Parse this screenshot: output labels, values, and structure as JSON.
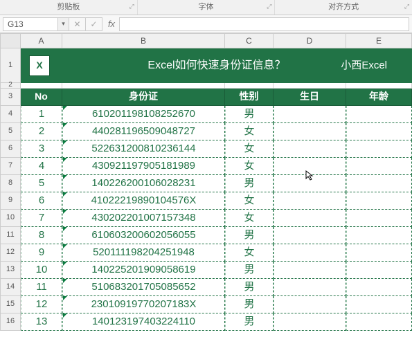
{
  "ribbon": {
    "sections": [
      "剪贴板",
      "字体",
      "对齐方式"
    ]
  },
  "namebox": "G13",
  "colHeaders": [
    "A",
    "B",
    "C",
    "D",
    "E"
  ],
  "title": {
    "icon": "X",
    "text": "Excel如何快速身份证信息？",
    "author": "小西Excel"
  },
  "headers": {
    "no": "No",
    "id": "身份证",
    "gender": "性别",
    "birth": "生日",
    "age": "年龄"
  },
  "rows": [
    {
      "n": "1",
      "id": "610201198108252670",
      "g": "男"
    },
    {
      "n": "2",
      "id": "440281196509048727",
      "g": "女"
    },
    {
      "n": "3",
      "id": "522631200810236144",
      "g": "女"
    },
    {
      "n": "4",
      "id": "430921197905181989",
      "g": "女"
    },
    {
      "n": "5",
      "id": "140226200106028231",
      "g": "男"
    },
    {
      "n": "6",
      "id": "41022219890104576X",
      "g": "女"
    },
    {
      "n": "7",
      "id": "430202201007157348",
      "g": "女"
    },
    {
      "n": "8",
      "id": "610603200602056055",
      "g": "男"
    },
    {
      "n": "9",
      "id": "520111198204251948",
      "g": "女"
    },
    {
      "n": "10",
      "id": "140225201909058619",
      "g": "男"
    },
    {
      "n": "11",
      "id": "510683201705085652",
      "g": "男"
    },
    {
      "n": "12",
      "id": "23010919770207183X",
      "g": "男"
    },
    {
      "n": "13",
      "id": "140123197403224110",
      "g": "男"
    }
  ]
}
